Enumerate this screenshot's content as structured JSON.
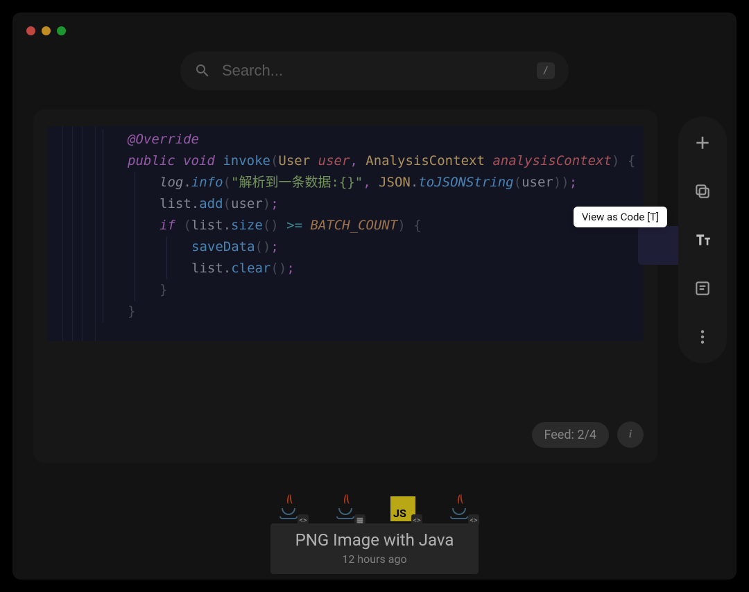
{
  "search": {
    "placeholder": "Search...",
    "shortcut": "/"
  },
  "code": {
    "lines": [
      [
        [
          "anno",
          "@Override"
        ]
      ],
      [
        [
          "kw",
          "public"
        ],
        [
          "sp",
          " "
        ],
        [
          "kw",
          "void"
        ],
        [
          "sp",
          " "
        ],
        [
          "method",
          "invoke"
        ],
        [
          "punct",
          "("
        ],
        [
          "type",
          "User"
        ],
        [
          "sp",
          " "
        ],
        [
          "param",
          "user"
        ],
        [
          "punct2",
          ","
        ],
        [
          "sp",
          " "
        ],
        [
          "type",
          "AnalysisContext"
        ],
        [
          "sp",
          " "
        ],
        [
          "param",
          "analysisContext"
        ],
        [
          "punct",
          ")"
        ],
        [
          "sp",
          " "
        ],
        [
          "punct",
          "{"
        ]
      ],
      [
        [
          "identi",
          "log"
        ],
        [
          "dot",
          "."
        ],
        [
          "methodi",
          "info"
        ],
        [
          "punct",
          "("
        ],
        [
          "str",
          "\"解析到一条数据:{}\""
        ],
        [
          "punct2",
          ","
        ],
        [
          "sp",
          " "
        ],
        [
          "type",
          "JSON"
        ],
        [
          "dot",
          "."
        ],
        [
          "methodi",
          "toJSONString"
        ],
        [
          "punct",
          "("
        ],
        [
          "ident",
          "user"
        ],
        [
          "punct",
          "))"
        ],
        [
          "punct2",
          ";"
        ]
      ],
      [
        [
          "ident",
          "list"
        ],
        [
          "dot",
          "."
        ],
        [
          "method",
          "add"
        ],
        [
          "punct",
          "("
        ],
        [
          "ident",
          "user"
        ],
        [
          "punct",
          ")"
        ],
        [
          "punct2",
          ";"
        ]
      ],
      [
        [
          "kw",
          "if"
        ],
        [
          "sp",
          " "
        ],
        [
          "punct",
          "("
        ],
        [
          "ident",
          "list"
        ],
        [
          "dot",
          "."
        ],
        [
          "method",
          "size"
        ],
        [
          "punct",
          "()"
        ],
        [
          "sp",
          " "
        ],
        [
          "op",
          ">="
        ],
        [
          "sp",
          " "
        ],
        [
          "const",
          "BATCH_COUNT"
        ],
        [
          "punct",
          ")"
        ],
        [
          "sp",
          " "
        ],
        [
          "punct",
          "{"
        ]
      ],
      [
        [
          "method",
          "saveData"
        ],
        [
          "punct",
          "()"
        ],
        [
          "punct2",
          ";"
        ]
      ],
      [
        [
          "ident",
          "list"
        ],
        [
          "dot",
          "."
        ],
        [
          "method",
          "clear"
        ],
        [
          "punct",
          "()"
        ],
        [
          "punct2",
          ";"
        ]
      ],
      [
        [
          "punct",
          "}"
        ]
      ],
      [
        [
          "punct",
          "}"
        ]
      ]
    ],
    "indents": [
      2,
      2,
      3,
      3,
      3,
      4,
      4,
      3,
      2
    ]
  },
  "feed": {
    "label": "Feed: 2/4"
  },
  "tooltip": {
    "text": "View as Code [T]"
  },
  "thumbs": [
    {
      "kind": "java",
      "sub": "code"
    },
    {
      "kind": "java",
      "sub": "image"
    },
    {
      "kind": "js",
      "sub": "code"
    },
    {
      "kind": "java",
      "sub": "code"
    }
  ],
  "caption": {
    "title": "PNG Image with Java",
    "time": "12 hours ago"
  },
  "sidebar": {
    "items": [
      "add",
      "copy",
      "text",
      "note",
      "more"
    ],
    "active": "text"
  }
}
